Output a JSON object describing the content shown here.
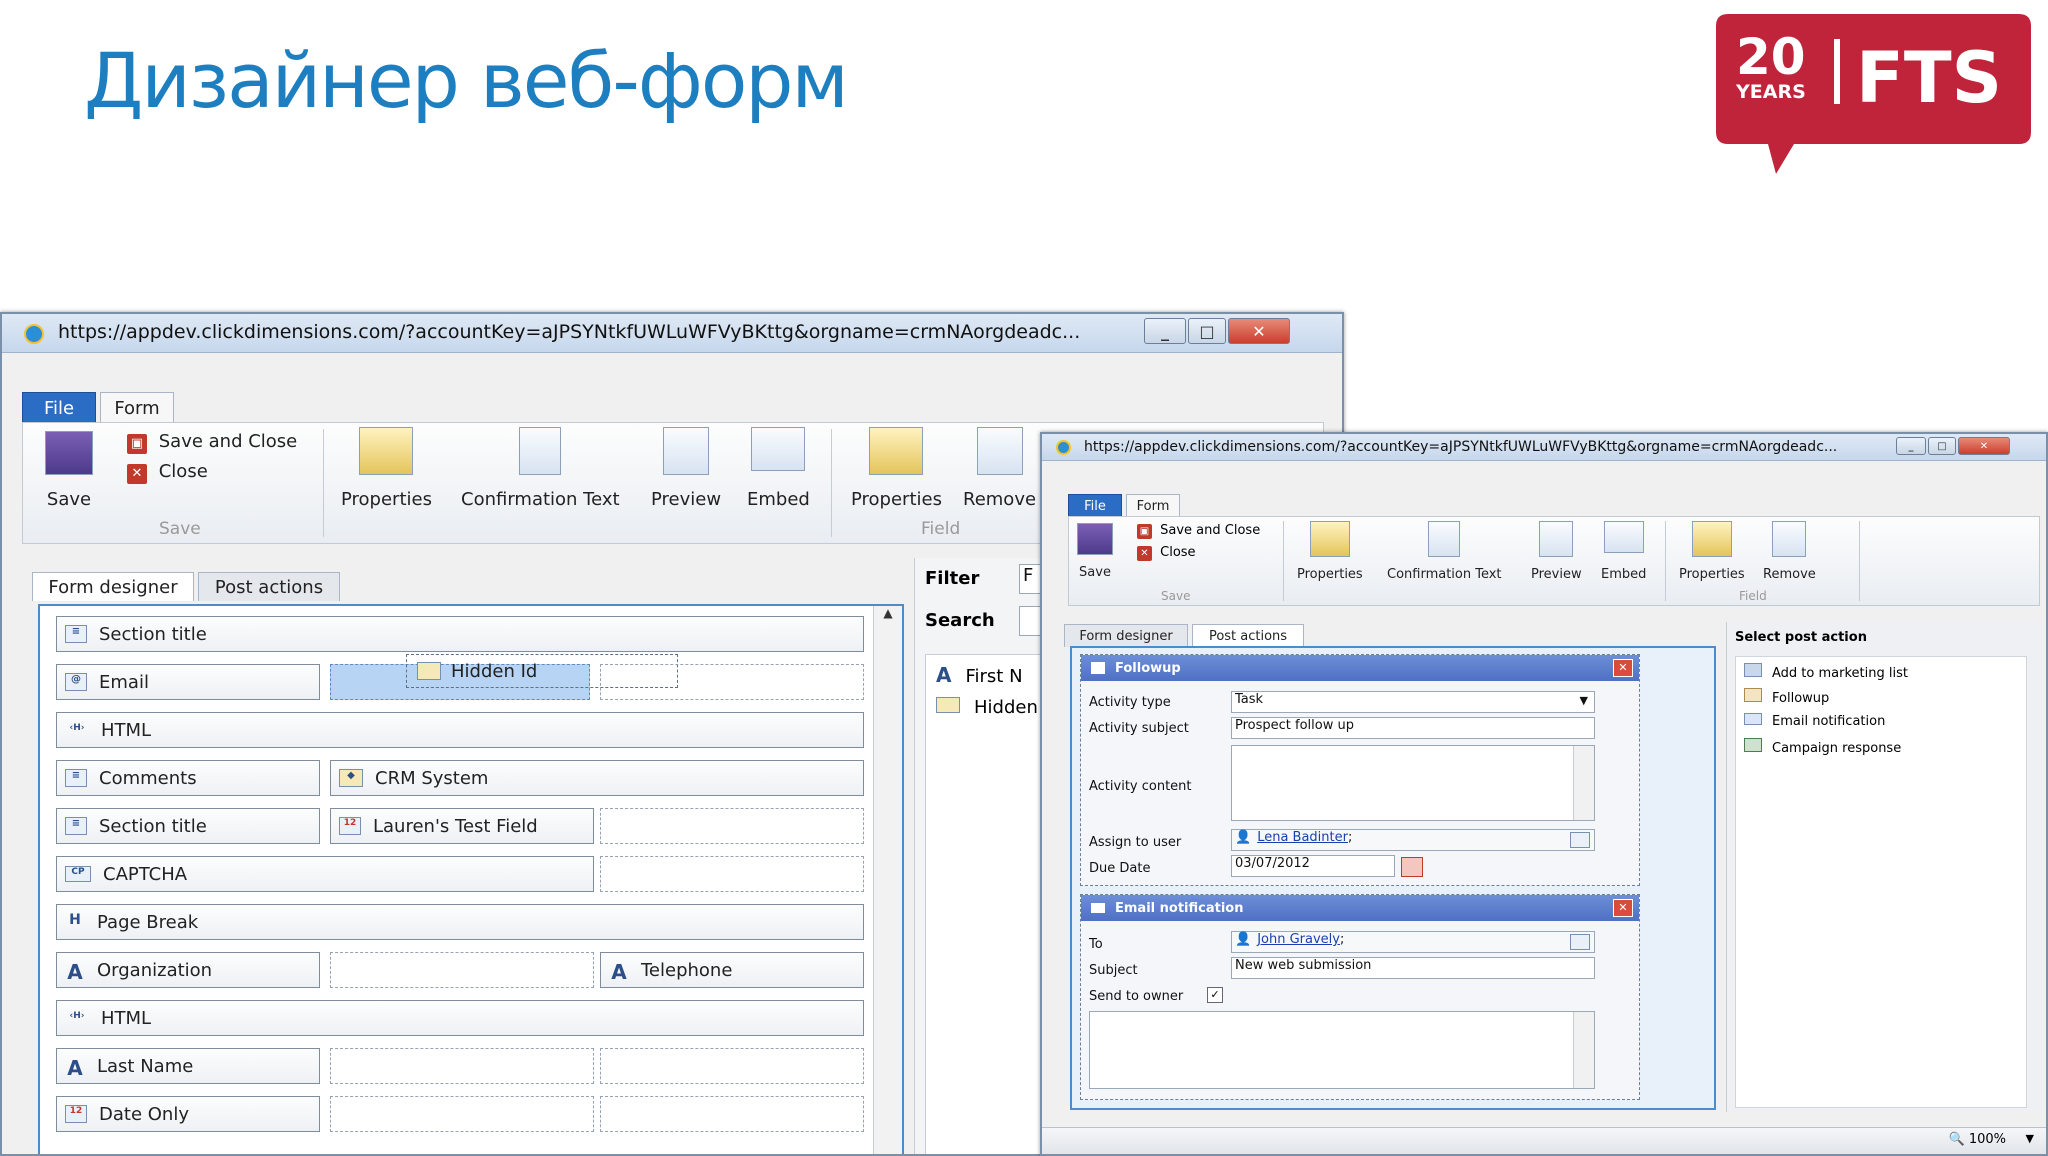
{
  "slide": {
    "title": "Дизайнер веб-форм"
  },
  "logo": {
    "number": "20",
    "years": "YEARS",
    "brand": "FTS",
    "color": "#c0243a"
  },
  "back_window": {
    "url": "https://appdev.clickdimensions.com/?accountKey=aJPSYNtkfUWLuWFVyBKttg&orgname=crmNAorgdeadc...",
    "tabs": [
      "File",
      "Form"
    ],
    "ribbon": {
      "save": "Save",
      "save_and_close": "Save and Close",
      "close": "Close",
      "group_save": "Save",
      "properties": "Properties",
      "confirmation_text": "Confirmation Text",
      "preview": "Preview",
      "embed": "Embed",
      "field_properties": "Properties",
      "remove": "Remove",
      "group_field": "Field"
    },
    "content_tabs": [
      "Form designer",
      "Post actions"
    ],
    "drag_item": "Hidden Id",
    "fields": {
      "section_title_1": "Section title",
      "email": "Email",
      "html_1": "HTML",
      "comments": "Comments",
      "crm_system": "CRM System",
      "section_title_2": "Section title",
      "laurens_test": "Lauren's Test Field",
      "captcha": "CAPTCHA",
      "page_break": "Page Break",
      "organization": "Organization",
      "telephone": "Telephone",
      "html_2": "HTML",
      "last_name": "Last Name",
      "date_only": "Date Only"
    },
    "side": {
      "filter": "Filter",
      "filter_value": "F",
      "search": "Search",
      "items": [
        "First N",
        "Hidden"
      ]
    }
  },
  "front_window": {
    "url": "https://appdev.clickdimensions.com/?accountKey=aJPSYNtkfUWLuWFVyBKttg&orgname=crmNAorgdeadc...",
    "tabs": [
      "File",
      "Form"
    ],
    "ribbon": {
      "save": "Save",
      "save_and_close": "Save and Close",
      "close": "Close",
      "group_save": "Save",
      "properties": "Properties",
      "confirmation_text": "Confirmation Text",
      "preview": "Preview",
      "embed": "Embed",
      "field_properties": "Properties",
      "remove": "Remove",
      "group_field": "Field"
    },
    "content_tabs": [
      "Form designer",
      "Post actions"
    ],
    "followup": {
      "header": "Followup",
      "activity_type_label": "Activity type",
      "activity_type_value": "Task",
      "activity_subject_label": "Activity subject",
      "activity_subject_value": "Prospect follow up",
      "activity_content_label": "Activity content",
      "assign_label": "Assign to user",
      "assign_value": "Lena Badinter",
      "due_label": "Due Date",
      "due_value": "03/07/2012"
    },
    "email_notification": {
      "header": "Email notification",
      "to_label": "To",
      "to_value": "John Gravely",
      "subject_label": "Subject",
      "subject_value": "New web submission",
      "send_owner_label": "Send to owner",
      "send_owner_checked": "✓"
    },
    "post_action_panel": {
      "title": "Select post action",
      "items": [
        "Add to marketing list",
        "Followup",
        "Email notification",
        "Campaign response"
      ]
    },
    "status": {
      "zoom": "100%"
    }
  }
}
